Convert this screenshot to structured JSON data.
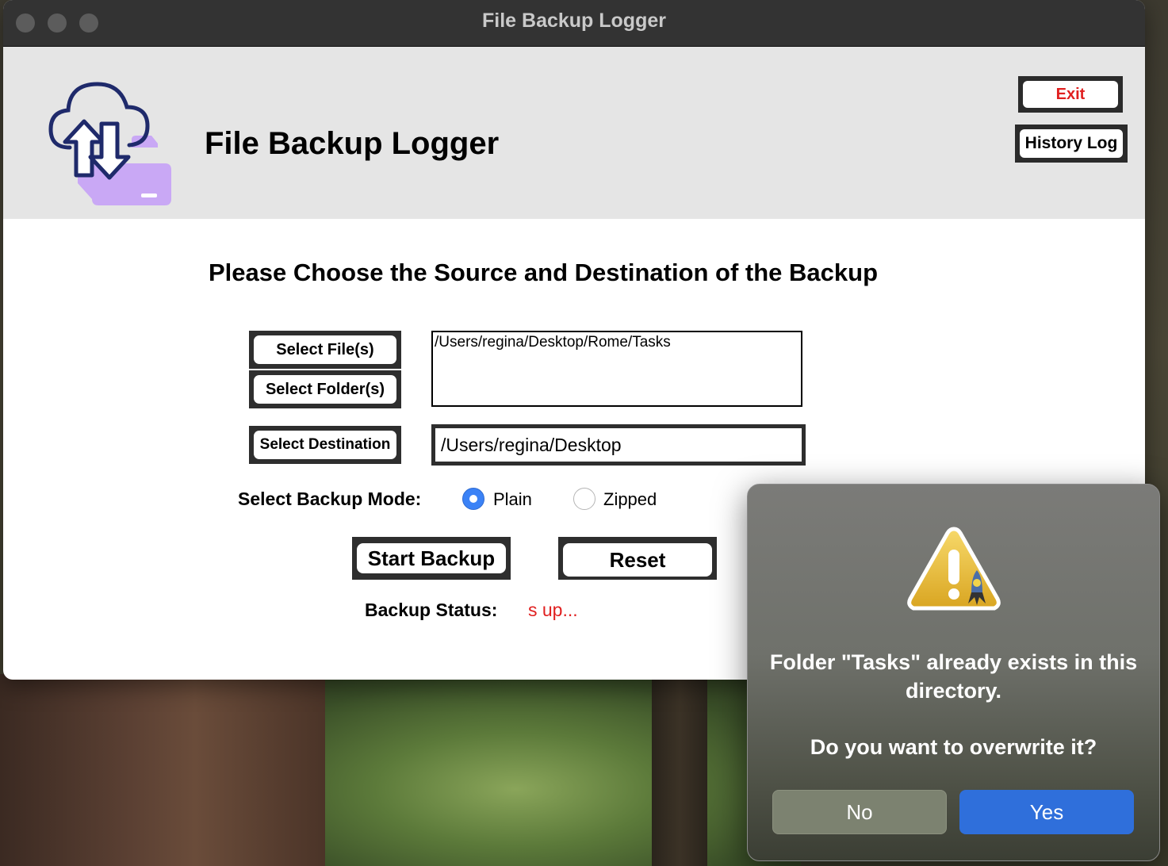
{
  "window": {
    "title": "File Backup Logger"
  },
  "header": {
    "app_title": "File Backup Logger",
    "exit_label": "Exit",
    "history_label": "History Log",
    "logo_icon": "cloud-upload-download-folder-icon"
  },
  "main": {
    "prompt": "Please Choose the Source and Destination of the Backup",
    "select_files_label": "Select File(s)",
    "select_folders_label": "Select Folder(s)",
    "select_destination_label": "Select Destination",
    "source_paths": "/Users/regina/Desktop/Rome/Tasks",
    "destination_path": "/Users/regina/Desktop",
    "backup_mode_label": "Select Backup Mode:",
    "mode_options": [
      "Plain",
      "Zipped"
    ],
    "mode_selected": "Plain",
    "start_label": "Start Backup",
    "reset_label": "Reset",
    "status_label": "Backup Status:",
    "status_value": "s up..."
  },
  "dialog": {
    "message": "Folder \"Tasks\" already exists in this directory.",
    "question": "Do you want to overwrite it?",
    "no_label": "No",
    "yes_label": "Yes",
    "icon": "warning-icon"
  },
  "colors": {
    "accent_blue": "#2f6fdb",
    "exit_red": "#e02020",
    "status_red": "#e02020",
    "logo_navy": "#1f2a6b",
    "logo_purple": "#c9a8f5"
  }
}
